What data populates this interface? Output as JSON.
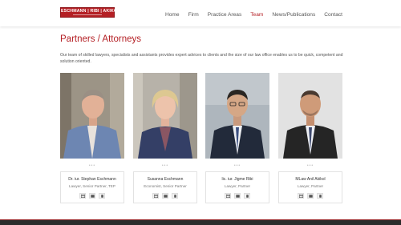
{
  "logo": {
    "text": "ESCHMANN | RIBI | AKIKOL"
  },
  "nav": {
    "items": [
      "Home",
      "Firm",
      "Practice Areas",
      "Team",
      "News/Publications",
      "Contact"
    ],
    "active": "Team"
  },
  "page": {
    "title": "Partners / Attorneys",
    "intro": "Our team of skilled lawyers, specialists and assistants provides expert advices to clients and the size of our law office enables us to be quick, competent and solution oriented."
  },
  "team": [
    {
      "name": "Dr. iur. Stephan Eschmann",
      "role": "Lawyer, Senior Partner, TEP",
      "contacts": [
        "email-icon",
        "card-icon",
        "phone-icon"
      ]
    },
    {
      "name": "Susanna Eschmann",
      "role": "Economist, Senior Partner",
      "contacts": [
        "email-icon",
        "card-icon",
        "phone-icon"
      ]
    },
    {
      "name": "lic. iur. Jigme Ribi",
      "role": "Lawyer, Partner",
      "contacts": [
        "email-icon",
        "card-icon",
        "phone-icon"
      ]
    },
    {
      "name": "MLaw Anil Akikol",
      "role": "Lawyer, Partner",
      "contacts": [
        "email-icon",
        "card-icon",
        "phone-icon"
      ]
    }
  ],
  "colors": {
    "accent": "#b41f24",
    "footer": "#2b2b2b"
  }
}
